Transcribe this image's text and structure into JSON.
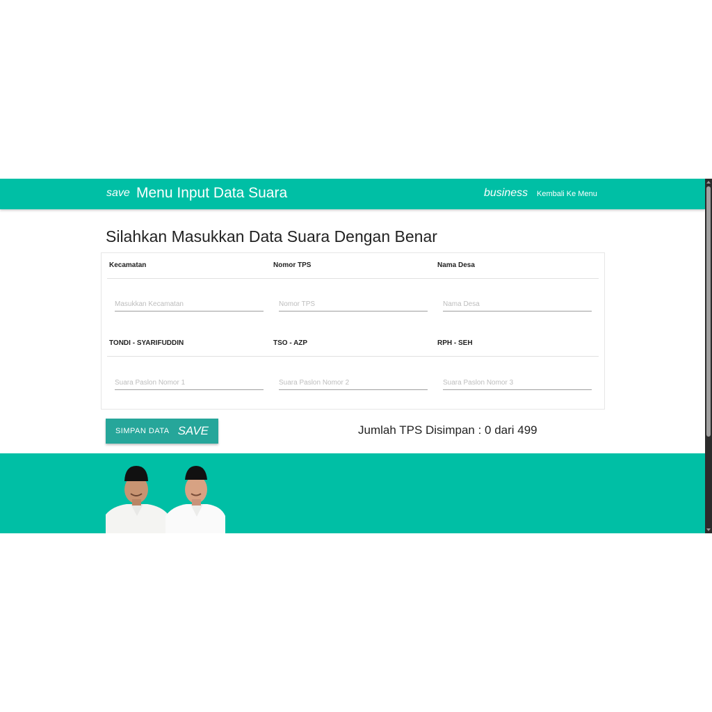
{
  "navbar": {
    "save_icon": "save",
    "title": "Menu Input Data Suara",
    "business_icon": "business",
    "back_link": "Kembali Ke Menu"
  },
  "heading": "Silahkan Masukkan Data Suara Dengan Benar",
  "form": {
    "row1": [
      {
        "label": "Kecamatan",
        "placeholder": "Masukkan Kecamatan",
        "value": ""
      },
      {
        "label": "Nomor TPS",
        "placeholder": "Nomor TPS",
        "value": ""
      },
      {
        "label": "Nama Desa",
        "placeholder": "Nama Desa",
        "value": ""
      }
    ],
    "row2": [
      {
        "label": "TONDI - SYARIFUDDIN",
        "placeholder": "Suara Paslon Nomor 1",
        "value": ""
      },
      {
        "label": "TSO - AZP",
        "placeholder": "Suara Paslon Nomor 2",
        "value": ""
      },
      {
        "label": "RPH - SEH",
        "placeholder": "Suara Paslon Nomor 3",
        "value": ""
      }
    ]
  },
  "actions": {
    "save_label": "SIMPAN DATA",
    "save_icon": "SAVE"
  },
  "status": {
    "tps_saved": "Jumlah TPS Disimpan : 0 dari 499"
  },
  "colors": {
    "primary": "#00bfa5",
    "button": "#26a69a"
  },
  "footer": {
    "image": "candidate-photo"
  }
}
